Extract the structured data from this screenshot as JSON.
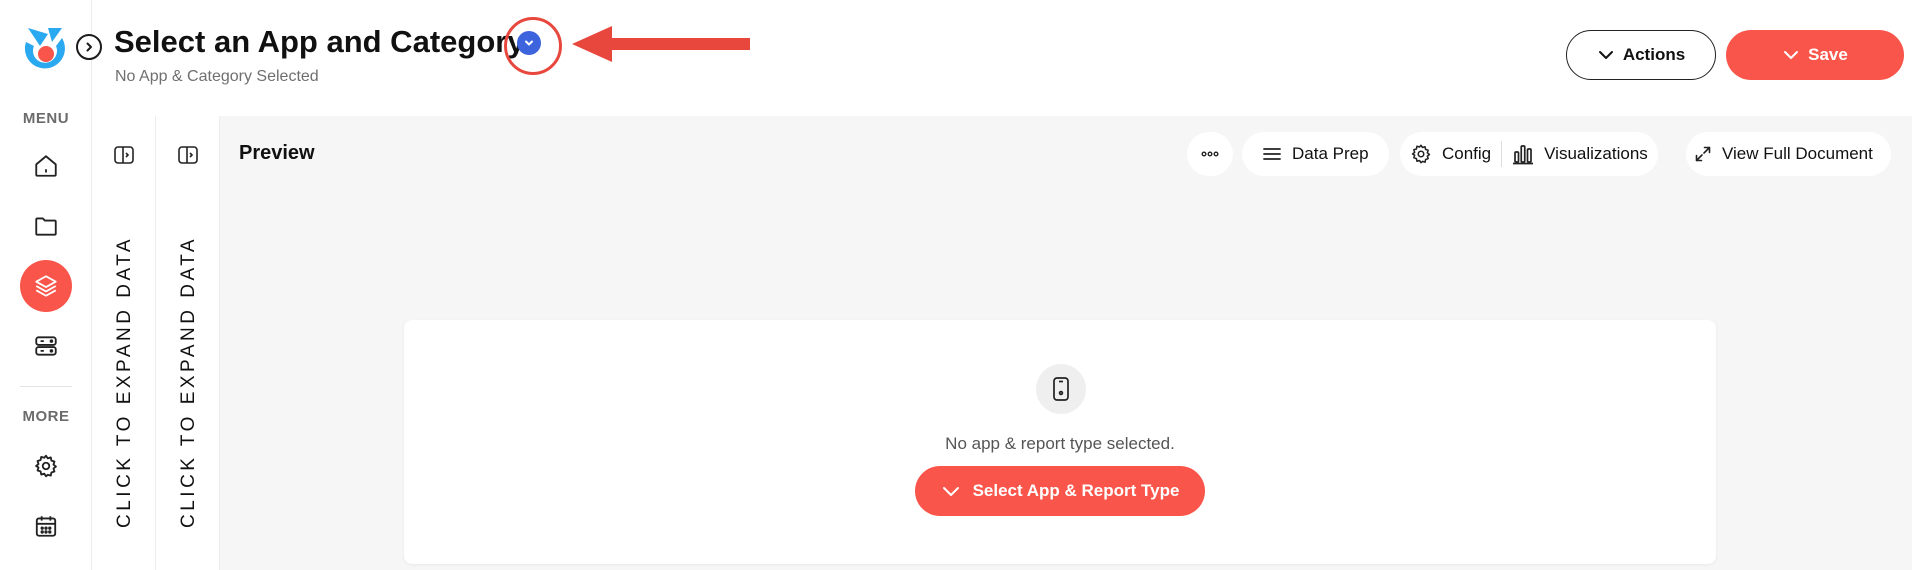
{
  "header": {
    "title": "Select an App and Category",
    "subtitle": "No App & Category Selected",
    "actions_label": "Actions",
    "save_label": "Save"
  },
  "sidebar": {
    "menu_heading": "MENU",
    "more_heading": "MORE",
    "menu_items": [
      {
        "icon": "home-icon"
      },
      {
        "icon": "folder-icon"
      },
      {
        "icon": "layers-icon",
        "active": true
      },
      {
        "icon": "server-icon"
      }
    ],
    "more_items": [
      {
        "icon": "gear-icon"
      },
      {
        "icon": "calendar-icon"
      }
    ]
  },
  "panels": [
    {
      "label": "CLICK TO EXPAND DATA"
    },
    {
      "label": "CLICK TO EXPAND DATA"
    }
  ],
  "preview": {
    "title": "Preview",
    "toolbar": {
      "data_prep": "Data Prep",
      "config": "Config",
      "visualizations": "Visualizations",
      "view_full_document": "View Full Document"
    },
    "empty_state": {
      "message": "No app & report type selected.",
      "button_label": "Select App & Report Type"
    }
  },
  "colors": {
    "accent": "#f9554a",
    "dropdown_blue": "#3d63dd",
    "annotation_red": "#e8473d",
    "logo_blue": "#2aa8f0",
    "preview_bg": "#f6f6f6"
  }
}
